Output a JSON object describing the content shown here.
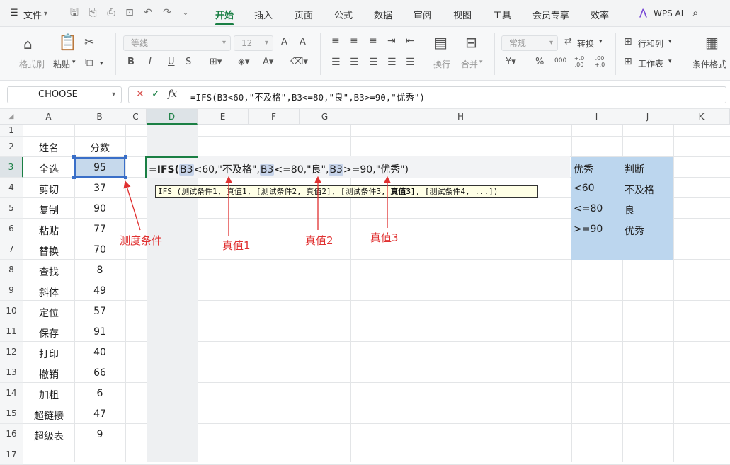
{
  "menubar": {
    "file": "文件",
    "tabs": [
      {
        "label": "开始",
        "active": true
      },
      {
        "label": "插入",
        "active": false
      },
      {
        "label": "页面",
        "active": false
      },
      {
        "label": "公式",
        "active": false
      },
      {
        "label": "数据",
        "active": false
      },
      {
        "label": "审阅",
        "active": false
      },
      {
        "label": "视图",
        "active": false
      },
      {
        "label": "工具",
        "active": false
      },
      {
        "label": "会员专享",
        "active": false
      },
      {
        "label": "效率",
        "active": false
      }
    ],
    "wps_ai": "WPS AI",
    "accent_color": "#1a7f44"
  },
  "ribbon": {
    "format_painter": "格式刷",
    "paste": "粘贴",
    "font_name": "等线",
    "font_size": "12",
    "bold": "B",
    "italic": "I",
    "underline": "U",
    "wrap": "换行",
    "merge": "合并",
    "number_format": "常规",
    "convert": "转换",
    "row_col": "行和列",
    "worksheet": "工作表",
    "conditional_format": "条件格式",
    "percent": "%",
    "thousands": "000",
    "inc_decimal": "+.0 .00",
    "dec_decimal": ".00 +.0"
  },
  "formula_bar": {
    "name_box": "CHOOSE",
    "formula": "=IFS(B3<60,\"不及格\",B3<=80,\"良\",B3>=90,\"优秀\")"
  },
  "columns": [
    "A",
    "B",
    "C",
    "D",
    "E",
    "F",
    "G",
    "H",
    "I",
    "J",
    "K"
  ],
  "rows": [
    "1",
    "2",
    "3",
    "4",
    "5",
    "6",
    "7",
    "8",
    "9",
    "10",
    "11",
    "12",
    "13",
    "14",
    "15",
    "16",
    "17"
  ],
  "table": {
    "header": {
      "name": "姓名",
      "score": "分数"
    },
    "data": [
      {
        "name": "全选",
        "score": "95"
      },
      {
        "name": "剪切",
        "score": "37"
      },
      {
        "name": "复制",
        "score": "90"
      },
      {
        "name": "粘贴",
        "score": "77"
      },
      {
        "name": "替换",
        "score": "70"
      },
      {
        "name": "查找",
        "score": "8"
      },
      {
        "name": "斜体",
        "score": "49"
      },
      {
        "name": "定位",
        "score": "57"
      },
      {
        "name": "保存",
        "score": "91"
      },
      {
        "name": "打印",
        "score": "40"
      },
      {
        "name": "撤销",
        "score": "66"
      },
      {
        "name": "加粗",
        "score": "6"
      },
      {
        "name": "超链接",
        "score": "47"
      },
      {
        "name": "超级表",
        "score": "9"
      }
    ]
  },
  "cell_edit": {
    "prefix": "=IFS(",
    "ref1": "B3",
    "part1": "<60,\"不及格\",",
    "ref2": "B3",
    "part2": "<=80,\"良\",",
    "ref3": "B3",
    "part3": ">=90,\"优秀\")"
  },
  "tooltip": {
    "pre": "IFS (测试条件1, 真值1, [测试条件2, 真值2], [测试条件3, ",
    "bold": "真值3]",
    "post": ", [测试条件4, ...])"
  },
  "lookup": [
    [
      "优秀",
      "判断"
    ],
    [
      "<60",
      "不及格"
    ],
    [
      "<=80",
      "良"
    ],
    [
      ">=90",
      "优秀"
    ]
  ],
  "annotations": {
    "condition": "测度条件",
    "true1": "真值1",
    "true2": "真值2",
    "true3": "真值3"
  }
}
